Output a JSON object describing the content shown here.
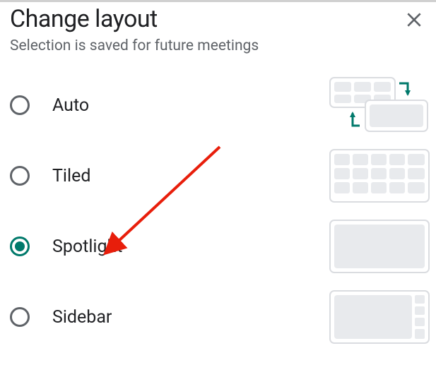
{
  "dialog": {
    "title": "Change layout",
    "subtitle": "Selection is saved for future meetings"
  },
  "options": [
    {
      "id": "auto",
      "label": "Auto",
      "selected": false
    },
    {
      "id": "tiled",
      "label": "Tiled",
      "selected": false
    },
    {
      "id": "spotlight",
      "label": "Spotlight",
      "selected": true
    },
    {
      "id": "sidebar",
      "label": "Sidebar",
      "selected": false
    }
  ],
  "colors": {
    "accent": "#00796b",
    "preview_tile": "#e8eaed",
    "preview_border": "#dadce0",
    "subtitle_text": "#5f6368",
    "annotation_arrow": "#e81e0b"
  }
}
